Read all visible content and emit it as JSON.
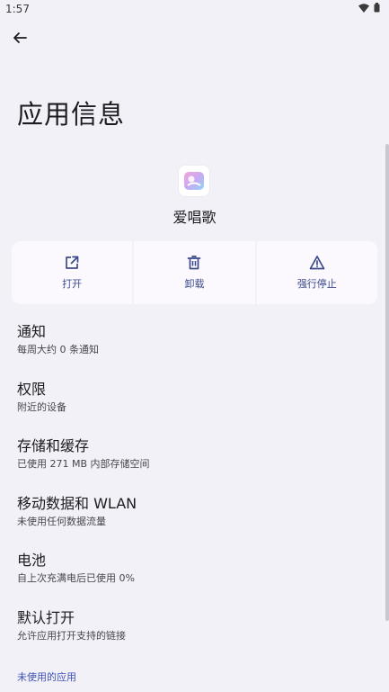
{
  "status_bar": {
    "time": "1:57"
  },
  "header": {
    "title": "应用信息"
  },
  "app": {
    "name": "爱唱歌"
  },
  "actions": [
    {
      "label": "打开",
      "icon": "open-external-icon"
    },
    {
      "label": "卸载",
      "icon": "trash-icon"
    },
    {
      "label": "强行停止",
      "icon": "warning-icon"
    }
  ],
  "settings": [
    {
      "title": "通知",
      "subtitle": "每周大约 0 条通知"
    },
    {
      "title": "权限",
      "subtitle": "附近的设备"
    },
    {
      "title": "存储和缓存",
      "subtitle": "已使用 271 MB 内部存储空间"
    },
    {
      "title": "移动数据和 WLAN",
      "subtitle": "未使用任何数据流量"
    },
    {
      "title": "电池",
      "subtitle": "自上次充满电后已使用 0%"
    },
    {
      "title": "默认打开",
      "subtitle": "允许应用打开支持的链接"
    }
  ],
  "section_footer": {
    "label": "未使用的应用"
  },
  "colors": {
    "accent": "#3d4a8a",
    "background": "#f3f1f8",
    "card": "#fbf9fe"
  }
}
